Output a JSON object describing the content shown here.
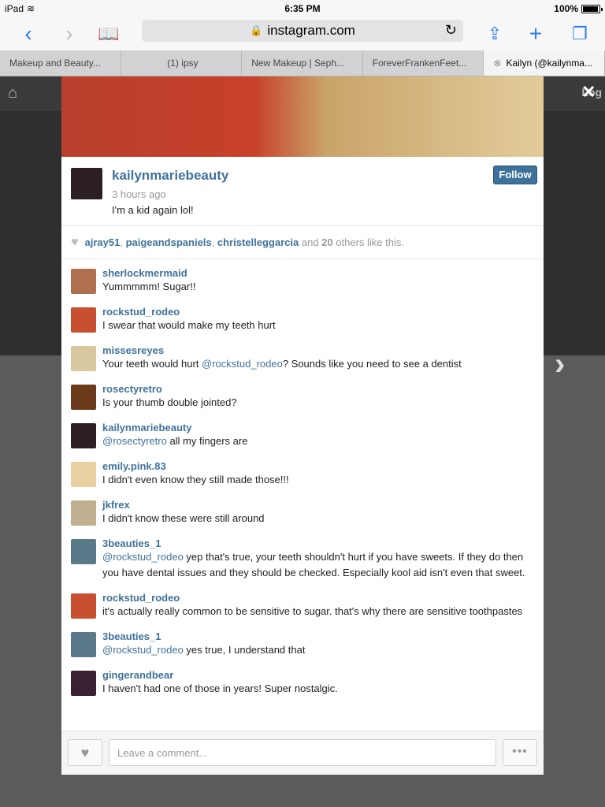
{
  "status": {
    "carrier": "iPad",
    "time": "6:35 PM",
    "battery": "100%"
  },
  "toolbar": {
    "url": "instagram.com"
  },
  "tabs": [
    {
      "label": "Makeup and Beauty..."
    },
    {
      "label": "(1) ipsy"
    },
    {
      "label": "New Makeup | Seph..."
    },
    {
      "label": "ForeverFrankenFeet..."
    },
    {
      "label": "Kailyn (@kailynma..."
    }
  ],
  "background": {
    "login": "Log"
  },
  "post": {
    "username": "kailynmariebeauty",
    "time": "3 hours ago",
    "caption": "I'm a kid again lol!",
    "follow_label": "Follow",
    "likes": {
      "user1": "ajray51",
      "user2": "paigeandspaniels",
      "user3": "christelleggarcia",
      "and": "and",
      "count": "20",
      "suffix": "others like this."
    }
  },
  "comments": [
    {
      "user": "sherlockmermaid",
      "text": "Yummmmm! Sugar!!"
    },
    {
      "user": "rockstud_rodeo",
      "text": "I swear that would make my teeth hurt"
    },
    {
      "user": "missesreyes",
      "mention": "@rockstud_rodeo",
      "text_before": "Your teeth would hurt ",
      "text_after": "? Sounds like you need to see a dentist"
    },
    {
      "user": "rosectyretro",
      "text": "Is your thumb double jointed?"
    },
    {
      "user": "kailynmariebeauty",
      "mention": "@rosectyretro",
      "text_after": " all my fingers are"
    },
    {
      "user": "emily.pink.83",
      "text": "I didn't even know they still made those!!!"
    },
    {
      "user": "jkfrex",
      "text": "I didn't know these were still around"
    },
    {
      "user": "3beauties_1",
      "mention": "@rockstud_rodeo",
      "text_after": " yep that's true, your teeth shouldn't hurt if you have sweets. If they do then you have dental issues and they should be checked. Especially kool aid isn't even that sweet."
    },
    {
      "user": "rockstud_rodeo",
      "text": "it's actually really common to be sensitive to sugar. that's why there are sensitive toothpastes"
    },
    {
      "user": "3beauties_1",
      "mention": "@rockstud_rodeo",
      "text_after": " yes true, I understand that"
    },
    {
      "user": "gingerandbear",
      "text": "I haven't had one of those in years! Super nostalgic."
    }
  ],
  "footer": {
    "placeholder": "Leave a comment...",
    "more": "•••"
  }
}
